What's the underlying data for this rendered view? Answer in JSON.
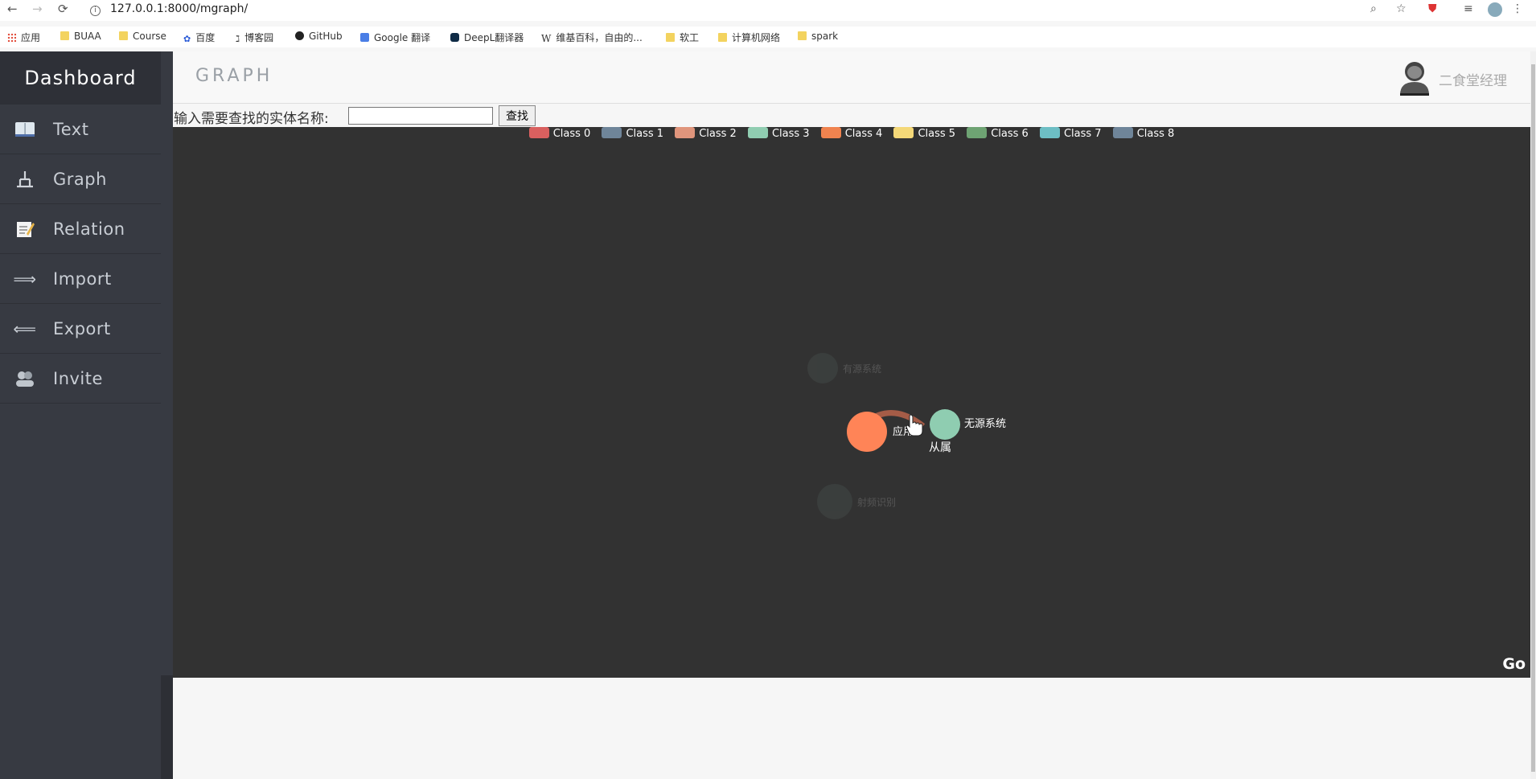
{
  "browser": {
    "url": "127.0.0.1:8000/mgraph/",
    "bookmarks": [
      {
        "label": "应用",
        "icon": "apps-grid-icon"
      },
      {
        "label": "BUAA",
        "icon": "folder-icon"
      },
      {
        "label": "Course",
        "icon": "folder-icon"
      },
      {
        "label": "百度",
        "icon": "baidu-icon"
      },
      {
        "label": "博客园",
        "icon": "cnblogs-icon"
      },
      {
        "label": "GitHub",
        "icon": "github-icon"
      },
      {
        "label": "Google 翻译",
        "icon": "google-translate-icon"
      },
      {
        "label": "DeepL翻译器",
        "icon": "deepl-icon"
      },
      {
        "label": "维基百科，自由的...",
        "icon": "wikipedia-icon"
      },
      {
        "label": "软工",
        "icon": "folder-icon"
      },
      {
        "label": "计算机网络",
        "icon": "folder-icon"
      },
      {
        "label": "spark",
        "icon": "folder-icon"
      }
    ]
  },
  "sidebar": {
    "brand": "Dashboard",
    "items": [
      {
        "label": "Text",
        "icon": "book-icon"
      },
      {
        "label": "Graph",
        "icon": "hierarchy-icon"
      },
      {
        "label": "Relation",
        "icon": "memo-icon"
      },
      {
        "label": "Import",
        "icon": "arrow-right-icon"
      },
      {
        "label": "Export",
        "icon": "arrow-left-icon"
      },
      {
        "label": "Invite",
        "icon": "people-icon"
      }
    ]
  },
  "header": {
    "title": "GRAPH",
    "user_name": "二食堂经理"
  },
  "search": {
    "label": "输入需要查找的实体名称:",
    "value": "",
    "button": "查找"
  },
  "graph": {
    "legend": [
      {
        "label": "Class 0",
        "color": "#d9605f"
      },
      {
        "label": "Class 1",
        "color": "#6f8599"
      },
      {
        "label": "Class 2",
        "color": "#e0957c"
      },
      {
        "label": "Class 3",
        "color": "#90cdb1"
      },
      {
        "label": "Class 4",
        "color": "#f0834f"
      },
      {
        "label": "Class 5",
        "color": "#f4d878"
      },
      {
        "label": "Class 6",
        "color": "#6ea373"
      },
      {
        "label": "Class 7",
        "color": "#6dbec4"
      },
      {
        "label": "Class 8",
        "color": "#6f8599"
      }
    ],
    "nodes": [
      {
        "label": "有源系统",
        "faded": true
      },
      {
        "label": "应用",
        "faded": false,
        "color": "#ff8457"
      },
      {
        "label": "无源系统",
        "faded": false,
        "color": "#8fcdb1"
      },
      {
        "label": "射频识别",
        "faded": true
      }
    ],
    "edge_label": "从属",
    "corner_label": "Go"
  }
}
